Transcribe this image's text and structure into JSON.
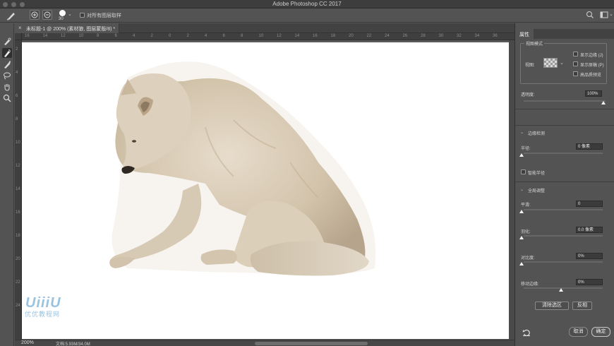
{
  "window": {
    "title": "Adobe Photoshop CC 2017"
  },
  "options_bar": {
    "brush_size": "30",
    "sample_all_layers_label": "对所有图层取样"
  },
  "tools": [
    {
      "name": "quick-selection-tool-icon",
      "active": false
    },
    {
      "name": "refine-edge-brush-tool-icon",
      "active": true
    },
    {
      "name": "brush-tool-icon",
      "active": false
    },
    {
      "name": "lasso-tool-icon",
      "active": false
    },
    {
      "name": "hand-tool-icon",
      "active": false
    },
    {
      "name": "zoom-tool-icon",
      "active": false
    }
  ],
  "document": {
    "tab_label": "未标题-1 @ 200% (素材狼, 图层蒙版/8) *",
    "close_glyph": "×"
  },
  "rulers": {
    "h_ticks": [
      "16",
      "14",
      "12",
      "10",
      "8",
      "6",
      "4",
      "2",
      "0",
      "2",
      "4",
      "6",
      "8",
      "10",
      "12",
      "14",
      "16",
      "18",
      "20",
      "22",
      "24",
      "26",
      "28",
      "30",
      "32",
      "34",
      "36"
    ],
    "v_ticks": [
      "2",
      "4",
      "6",
      "8",
      "10",
      "12",
      "14",
      "16",
      "18",
      "20",
      "22",
      "24"
    ]
  },
  "watermark": {
    "logo": "UiiiU",
    "text": "优优教程网"
  },
  "status": {
    "zoom": "200%",
    "doc_size": "文档:5.93M/34.0M"
  },
  "properties_panel": {
    "tab_label": "属性",
    "view_mode": {
      "legend": "视图模式",
      "view_label": "视图:",
      "show_edge": "显示边缘 (J)",
      "show_original": "显示原稿 (P)",
      "hq_preview": "高品质预览",
      "opacity_label": "透明度:",
      "opacity_value": "100%",
      "opacity_level": 1.0
    },
    "edge_detection": {
      "title": "边缘检测",
      "radius_label": "半径:",
      "radius_value": "0 像素",
      "radius_level": 0,
      "smart_radius_label": "智能半径"
    },
    "global_refinements": {
      "title": "全局调整",
      "smooth_label": "平滑:",
      "smooth_value": "0",
      "smooth_level": 0,
      "feather_label": "羽化:",
      "feather_value": "0.0 像素",
      "feather_level": 0,
      "contrast_label": "对比度:",
      "contrast_value": "0%",
      "contrast_level": 0,
      "shift_edge_label": "移动边缘:",
      "shift_edge_value": "0%",
      "shift_edge_level": 0.5
    },
    "clear_selection_label": "清除选区",
    "invert_label": "反相",
    "cancel_label": "取消",
    "ok_label": "确定"
  }
}
